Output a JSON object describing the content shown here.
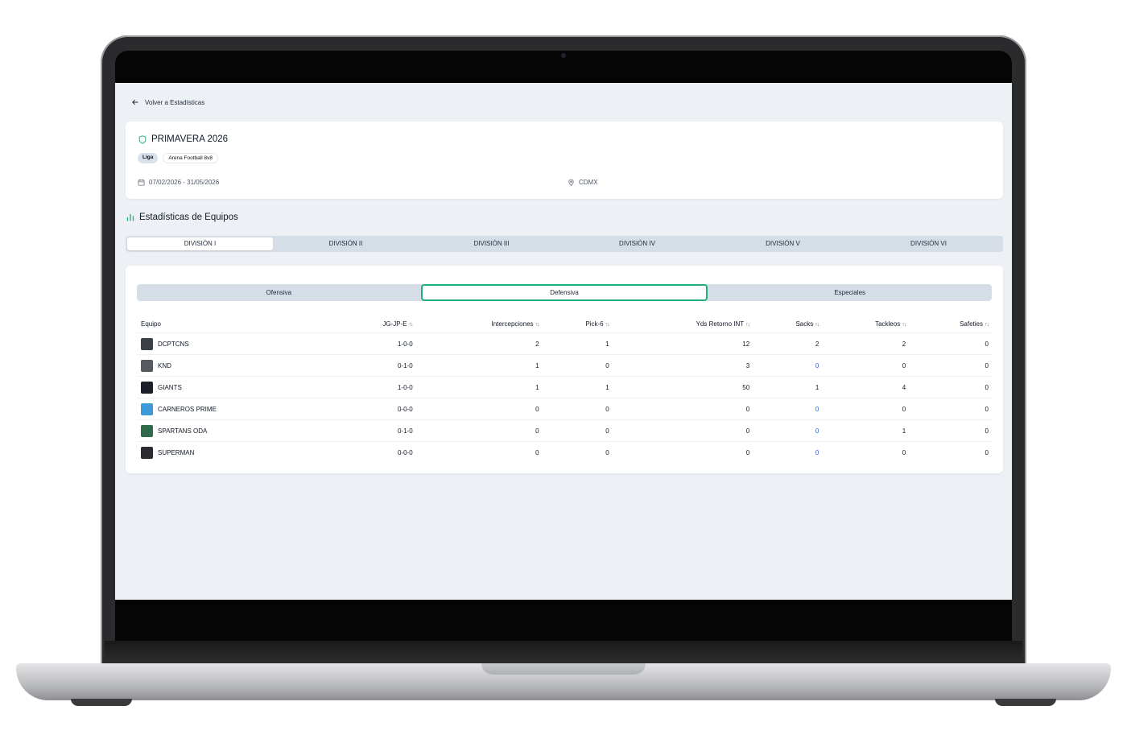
{
  "nav": {
    "back_label": "Volver a Estadísticas"
  },
  "season": {
    "title": "PRIMAVERA 2026",
    "badge_type": "Liga",
    "badge_format": "Arena Football 8v8",
    "dates": "07/02/2026 - 31/05/2026",
    "location": "CDMX"
  },
  "section": {
    "title": "Estadísticas de Equipos"
  },
  "divisions": [
    "DIVISIÓN I",
    "DIVISIÓN II",
    "DIVISIÓN III",
    "DIVISIÓN IV",
    "DIVISIÓN V",
    "DIVISIÓN VI"
  ],
  "active_division": "DIVISIÓN I",
  "subtabs": [
    "Ofensiva",
    "Defensiva",
    "Especiales"
  ],
  "active_subtab": "Defensiva",
  "table": {
    "columns": [
      "Equipo",
      "JG-JP-E",
      "Intercepciones",
      "Pick-6",
      "Yds Retorno INT",
      "Sacks",
      "Tackleos",
      "Safeties"
    ],
    "rows": [
      {
        "team": "DCPTCNS",
        "record": "1-0-0",
        "int": "2",
        "pick6": "1",
        "yds": "12",
        "sacks": "2",
        "tackles": "2",
        "safeties": "0",
        "logo_color": "#3b3f46"
      },
      {
        "team": "KND",
        "record": "0-1-0",
        "int": "1",
        "pick6": "0",
        "yds": "3",
        "sacks": "0",
        "tackles": "0",
        "safeties": "0",
        "logo_color": "#555a61"
      },
      {
        "team": "GIANTS",
        "record": "1-0-0",
        "int": "1",
        "pick6": "1",
        "yds": "50",
        "sacks": "1",
        "tackles": "4",
        "safeties": "0",
        "logo_color": "#1b1f2a"
      },
      {
        "team": "CARNEROS PRIME",
        "record": "0-0-0",
        "int": "0",
        "pick6": "0",
        "yds": "0",
        "sacks": "0",
        "tackles": "0",
        "safeties": "0",
        "logo_color": "#3d9ad8"
      },
      {
        "team": "SPARTANS ODA",
        "record": "0-1-0",
        "int": "0",
        "pick6": "0",
        "yds": "0",
        "sacks": "0",
        "tackles": "1",
        "safeties": "0",
        "logo_color": "#2f6b4b"
      },
      {
        "team": "SUPERMAN",
        "record": "0-0-0",
        "int": "0",
        "pick6": "0",
        "yds": "0",
        "sacks": "0",
        "tackles": "0",
        "safeties": "0",
        "logo_color": "#2a2c31"
      }
    ]
  },
  "colors": {
    "accent": "#22b07a",
    "background": "#edf1f5",
    "link": "#2563eb"
  }
}
